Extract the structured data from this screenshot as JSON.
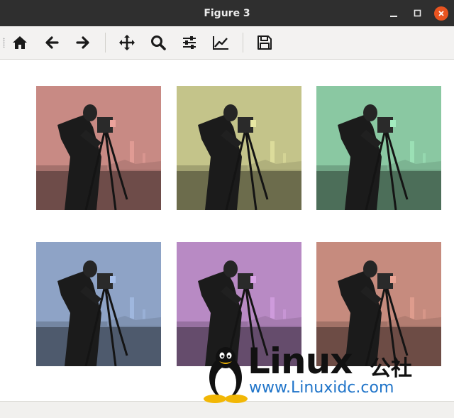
{
  "window": {
    "title": "Figure 3"
  },
  "toolbar": {
    "buttons": [
      {
        "name": "home",
        "icon": "home-icon"
      },
      {
        "name": "back",
        "icon": "arrow-left-icon"
      },
      {
        "name": "forward",
        "icon": "arrow-right-icon"
      },
      {
        "name": "pan",
        "icon": "move-icon"
      },
      {
        "name": "zoom",
        "icon": "magnifier-icon"
      },
      {
        "name": "configure-subplots",
        "icon": "sliders-icon"
      },
      {
        "name": "edit-axes",
        "icon": "line-chart-icon"
      },
      {
        "name": "save",
        "icon": "floppy-disk-icon"
      }
    ]
  },
  "figure": {
    "subplots": [
      {
        "tint": "#c88a84"
      },
      {
        "tint": "#c4c48a"
      },
      {
        "tint": "#8ac8a2"
      },
      {
        "tint": "#8ea3c6"
      },
      {
        "tint": "#b88ac4"
      },
      {
        "tint": "#c68b7e"
      }
    ]
  },
  "watermark": {
    "word": "Linux",
    "cn": "公社",
    "url": "www.Linuxidc.com"
  },
  "colors": {
    "titlebar": "#2f2f2f",
    "close": "#e95420",
    "toolbar": "#f3f2f1",
    "url": "#1f74c9"
  }
}
